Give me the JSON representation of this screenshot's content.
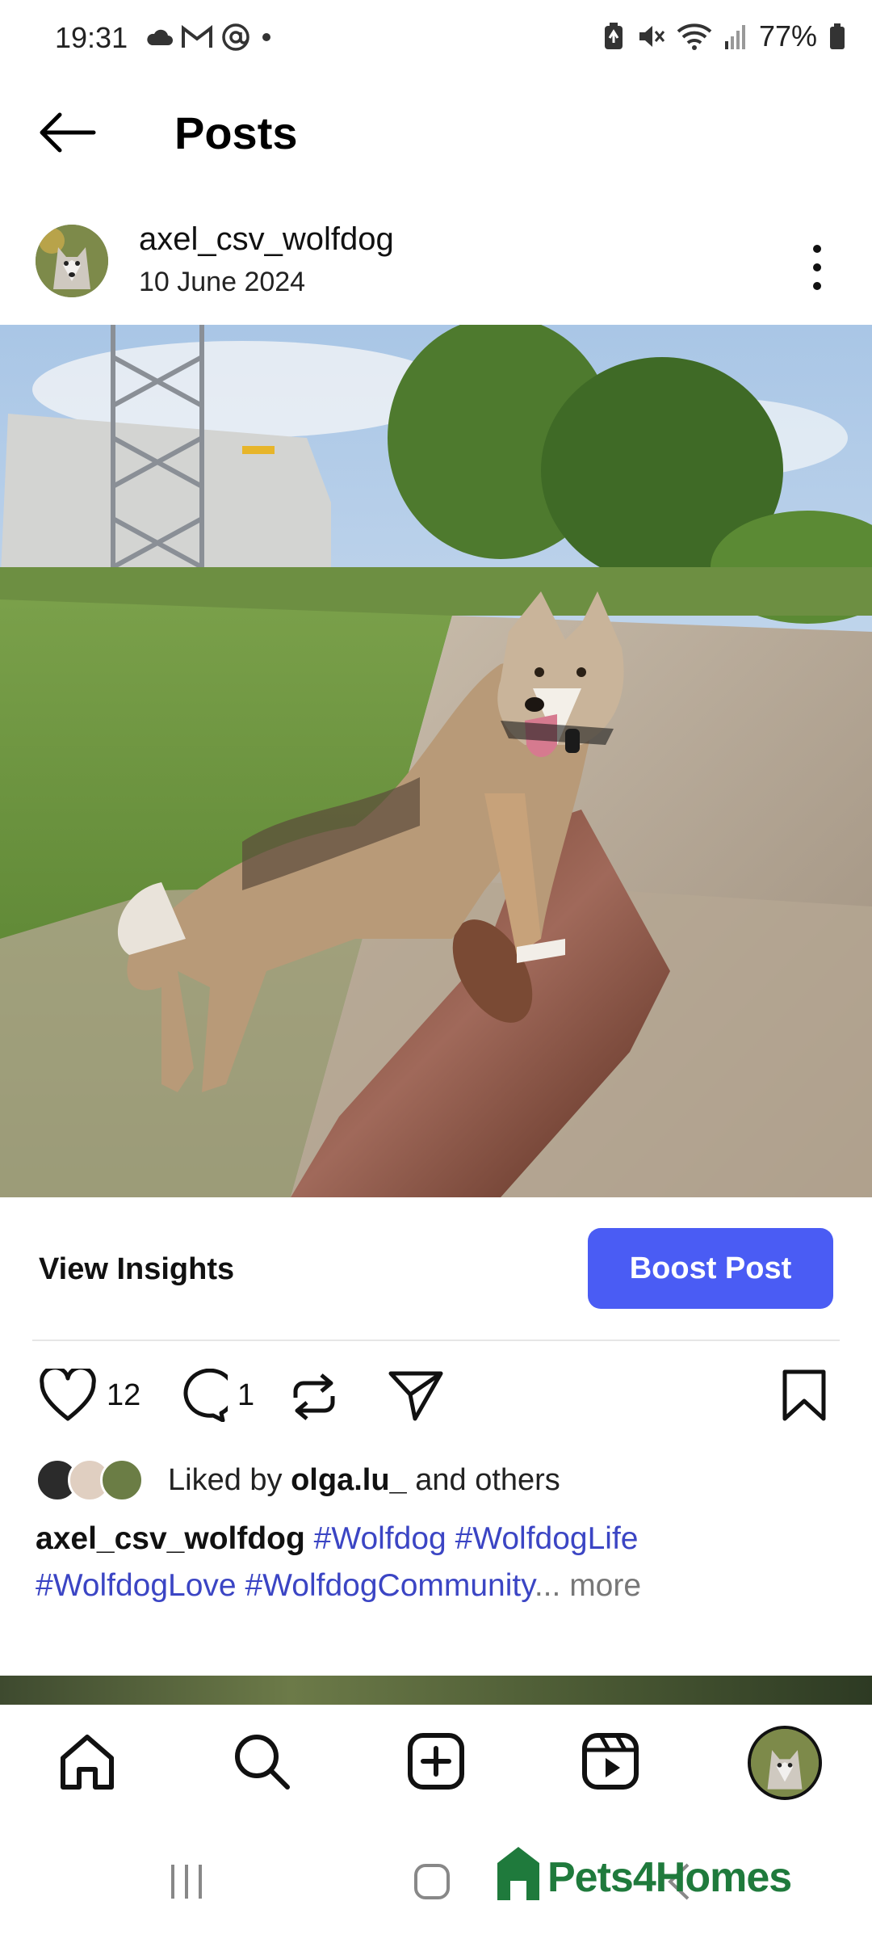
{
  "status_bar": {
    "time": "19:31",
    "battery": "77%",
    "left_icons": [
      "cloud-icon",
      "gmail-icon",
      "at-icon",
      "dot-icon"
    ],
    "right_icons": [
      "battery-saver-icon",
      "mute-icon",
      "wifi-icon",
      "signal-icon",
      "battery-icon"
    ]
  },
  "header": {
    "title": "Posts"
  },
  "post": {
    "username": "axel_csv_wolfdog",
    "date": "10 June 2024",
    "view_insights": "View Insights",
    "boost": "Boost Post",
    "likes_count": "12",
    "comments_count": "1",
    "liked_by_prefix": "Liked by ",
    "liked_by_user": "olga.lu_",
    "liked_by_suffix": " and others",
    "caption_user": "axel_csv_wolfdog",
    "hashtags": [
      "#Wolfdog",
      "#WolfdogLife",
      "#WolfdogLove",
      "#WolfdogCommunity"
    ],
    "ellipsis": "...",
    "more": " more"
  },
  "watermark": {
    "text": "Pets4Homes"
  },
  "colors": {
    "accent": "#4a5cf4",
    "hashtag": "#3b45c4",
    "watermark": "#1f7a3c"
  }
}
